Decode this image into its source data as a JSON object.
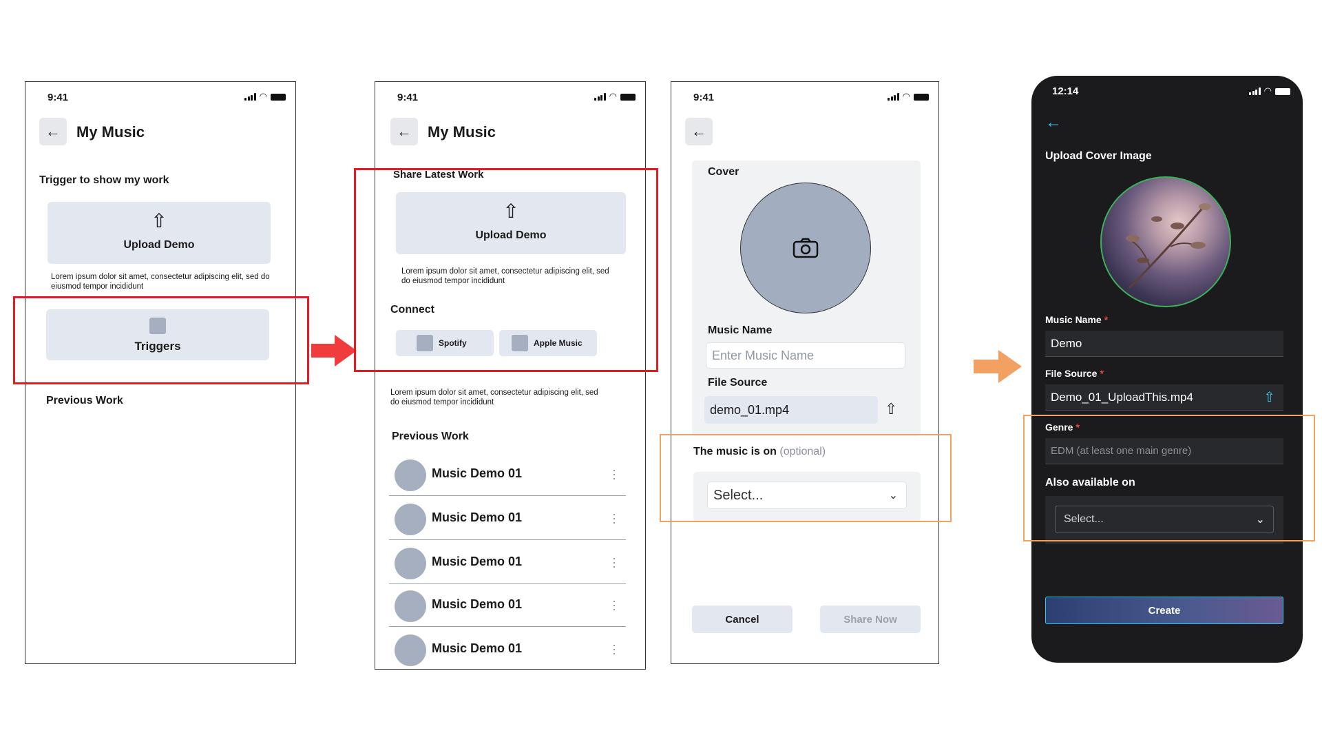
{
  "screen1": {
    "time": "9:41",
    "title": "My Music",
    "section_title": "Trigger to show my work",
    "upload_label": "Upload Demo",
    "lorem": "Lorem ipsum dolor sit amet, consectetur adipiscing elit, sed do eiusmod tempor incididunt",
    "triggers_label": "Triggers",
    "previous_work": "Previous Work"
  },
  "screen2": {
    "time": "9:41",
    "title": "My Music",
    "section_title": "Share Latest Work",
    "upload_label": "Upload Demo",
    "lorem1": "Lorem ipsum dolor sit amet, consectetur adipiscing elit, sed do eiusmod tempor incididunt",
    "connect": "Connect",
    "spotify": "Spotify",
    "apple_music": "Apple Music",
    "lorem2": "Lorem ipsum dolor sit amet, consectetur adipiscing elit, sed do eiusmod tempor incididunt",
    "previous_work": "Previous Work",
    "items": [
      "Music Demo 01",
      "Music Demo 01",
      "Music Demo 01",
      "Music Demo 01",
      "Music Demo 01"
    ]
  },
  "screen3": {
    "time": "9:41",
    "cover_label": "Cover",
    "music_name_label": "Music Name",
    "music_name_placeholder": "Enter Music Name",
    "file_source_label": "File Source",
    "file_source_value": "demo_01.mp4",
    "music_on_label": "The music is on",
    "optional": "(optional)",
    "select_placeholder": "Select...",
    "cancel": "Cancel",
    "share_now": "Share Now"
  },
  "screen4": {
    "time": "12:14",
    "upload_cover_title": "Upload Cover Image",
    "music_name_label": "Music Name",
    "music_name_value": "Demo",
    "file_source_label": "File Source",
    "file_source_value": "Demo_01_UploadThis.mp4",
    "genre_label": "Genre",
    "genre_placeholder": "EDM (at least one main genre)",
    "also_available_label": "Also available on",
    "select_placeholder": "Select...",
    "create": "Create",
    "required_mark": "*"
  },
  "colors": {
    "red_highlight": "#e31b23",
    "red_arrow": "#f03c3c",
    "orange_highlight": "#f3a162",
    "accent_teal": "#37c7e6",
    "dark_bg": "#1b1b1d"
  }
}
